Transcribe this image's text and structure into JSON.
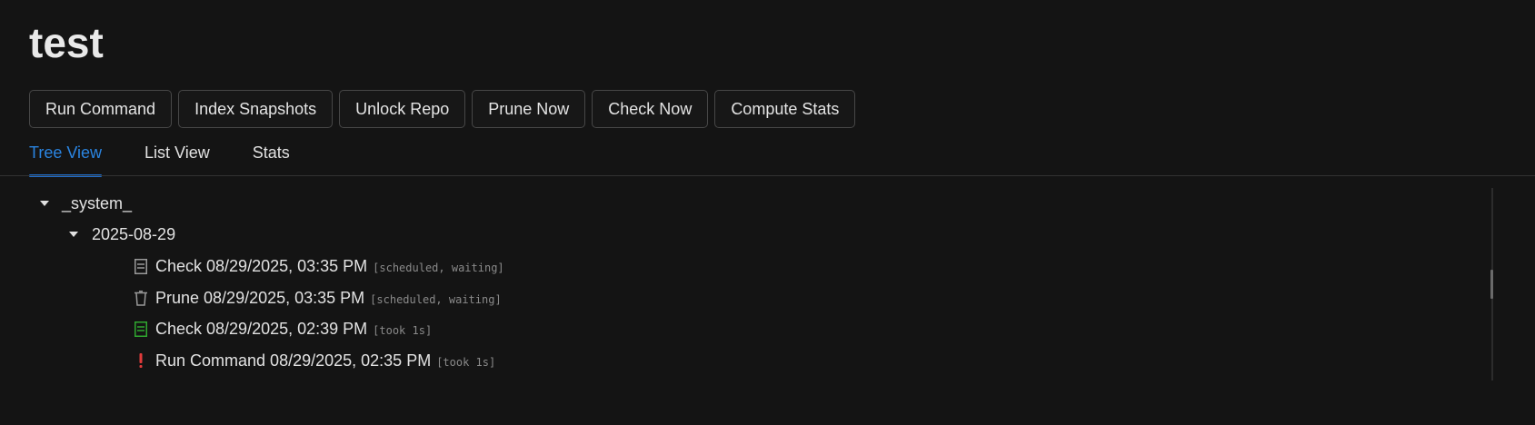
{
  "page": {
    "title": "test"
  },
  "toolbar": {
    "buttons": [
      {
        "label": "Run Command"
      },
      {
        "label": "Index Snapshots"
      },
      {
        "label": "Unlock Repo"
      },
      {
        "label": "Prune Now"
      },
      {
        "label": "Check Now"
      },
      {
        "label": "Compute Stats"
      }
    ]
  },
  "tabs": [
    {
      "label": "Tree View",
      "active": true
    },
    {
      "label": "List View",
      "active": false
    },
    {
      "label": "Stats",
      "active": false
    }
  ],
  "colors": {
    "accent": "#2a84e0",
    "success": "#2fa82f",
    "error": "#e23b3b",
    "muted_icon": "#9a9a9a"
  },
  "tree": {
    "root": {
      "label": "_system_",
      "expanded": true,
      "date_group": {
        "label": "2025-08-29",
        "expanded": true,
        "operations": [
          {
            "icon": "check-icon",
            "label": "Check 08/29/2025, 03:35 PM",
            "status": "[scheduled, waiting]",
            "state": "pending"
          },
          {
            "icon": "trash-icon",
            "label": "Prune 08/29/2025, 03:35 PM",
            "status": "[scheduled, waiting]",
            "state": "pending"
          },
          {
            "icon": "check-icon",
            "label": "Check 08/29/2025, 02:39 PM",
            "status": "[took 1s]",
            "state": "success"
          },
          {
            "icon": "exclamation-icon",
            "label": "Run Command 08/29/2025, 02:35 PM",
            "status": "[took 1s]",
            "state": "error"
          }
        ]
      }
    }
  }
}
